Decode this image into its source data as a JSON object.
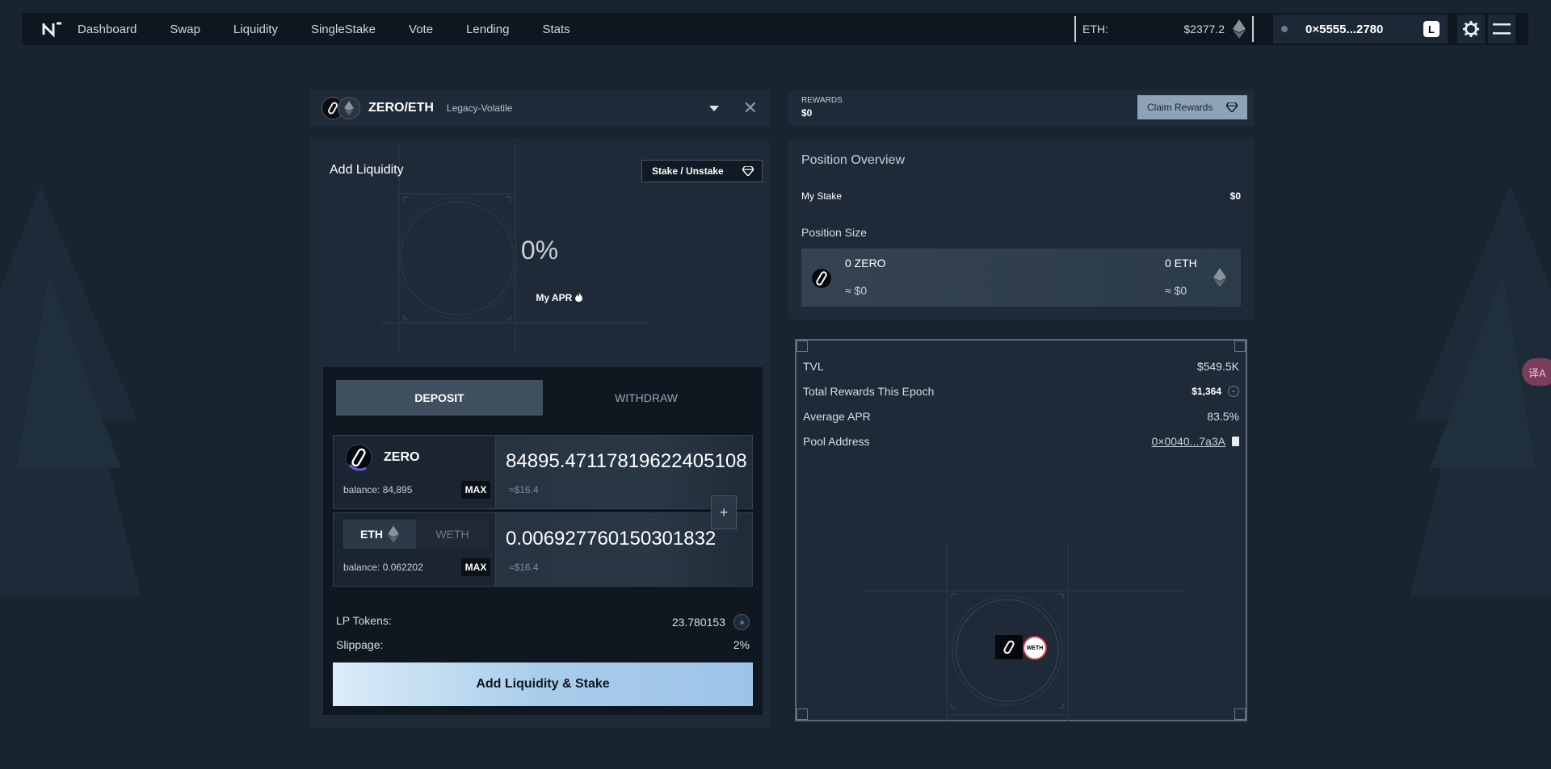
{
  "nav": {
    "items": [
      "Dashboard",
      "Swap",
      "Liquidity",
      "SingleStake",
      "Vote",
      "Lending",
      "Stats"
    ],
    "eth_label": "ETH:",
    "eth_price": "$2377.2",
    "wallet_address": "0×5555...2780",
    "wallet_badge": "L"
  },
  "pair": {
    "name": "ZERO/ETH",
    "type": "Legacy-Volatile"
  },
  "add": {
    "title": "Add Liquidity",
    "stake_unstake_label": "Stake / Unstake",
    "apr_value": "0%",
    "apr_label": "My APR",
    "tabs": [
      "DEPOSIT",
      "WITHDRAW"
    ],
    "active_tab": 0,
    "token_a": {
      "symbol": "ZERO",
      "balance": "balance: 84,895",
      "max_label": "MAX",
      "amount": "84895.47117819622405108",
      "usd": "≈$16.4"
    },
    "token_b": {
      "options": [
        "ETH",
        "WETH"
      ],
      "selected": "ETH",
      "balance": "balance: 0.062202",
      "max_label": "MAX",
      "amount": "0.006927760150301832",
      "usd": "≈$16.4"
    },
    "plus_label": "+",
    "lp_tokens_label": "LP Tokens:",
    "lp_tokens_value": "23.780153",
    "slippage_label": "Slippage:",
    "slippage_value": "2%",
    "submit_label": "Add Liquidity & Stake"
  },
  "rewards": {
    "label": "REWARDS",
    "value": "$0",
    "claim_label": "Claim Rewards"
  },
  "overview": {
    "title": "Position Overview",
    "my_stake_label": "My Stake",
    "my_stake_value": "$0",
    "position_size_label": "Position Size",
    "zero_amount": "0 ZERO",
    "zero_usd": "≈ $0",
    "eth_amount": "0 ETH",
    "eth_usd": "≈ $0"
  },
  "stats": {
    "tvl_label": "TVL",
    "tvl_value": "$549.5K",
    "rewards_epoch_label": "Total Rewards This Epoch",
    "rewards_epoch_value": "$1,364",
    "avg_apr_label": "Average APR",
    "avg_apr_value": "83.5%",
    "pool_address_label": "Pool Address",
    "pool_address_value": "0×0040...7a3A",
    "weth_badge": "WETH"
  },
  "translate_label": "译A",
  "colors": {
    "background": "#182430",
    "panel": "#1e2a37",
    "accent_button": "#a8cdea",
    "claim_button": "#8fa3b8"
  }
}
